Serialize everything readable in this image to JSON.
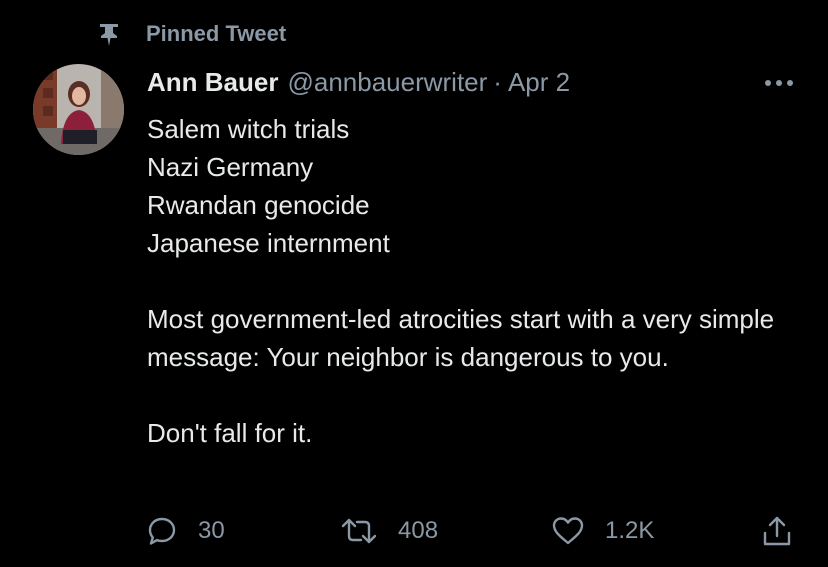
{
  "pinned": {
    "label": "Pinned Tweet",
    "icon": "pin-icon"
  },
  "author": {
    "name": "Ann Bauer",
    "handle": "@annbauerwriter",
    "separator": "·",
    "date": "Apr 2",
    "avatar_icon": "avatar"
  },
  "tweet": {
    "lines": [
      "Salem witch trials",
      "Nazi Germany",
      "Rwandan genocide",
      "Japanese internment"
    ],
    "paragraph": "Most government-led atrocities start with a very simple message: Your neighbor is dangerous to you.",
    "closing": "Don't fall for it."
  },
  "actions": {
    "reply": {
      "icon": "reply-icon",
      "count": "30"
    },
    "retweet": {
      "icon": "retweet-icon",
      "count": "408"
    },
    "like": {
      "icon": "heart-icon",
      "count": "1.2K"
    },
    "share": {
      "icon": "share-icon"
    }
  },
  "more": {
    "icon": "more-icon"
  },
  "colors": {
    "background": "#000000",
    "text": "#e7e9ea",
    "muted": "#8b98a5"
  }
}
